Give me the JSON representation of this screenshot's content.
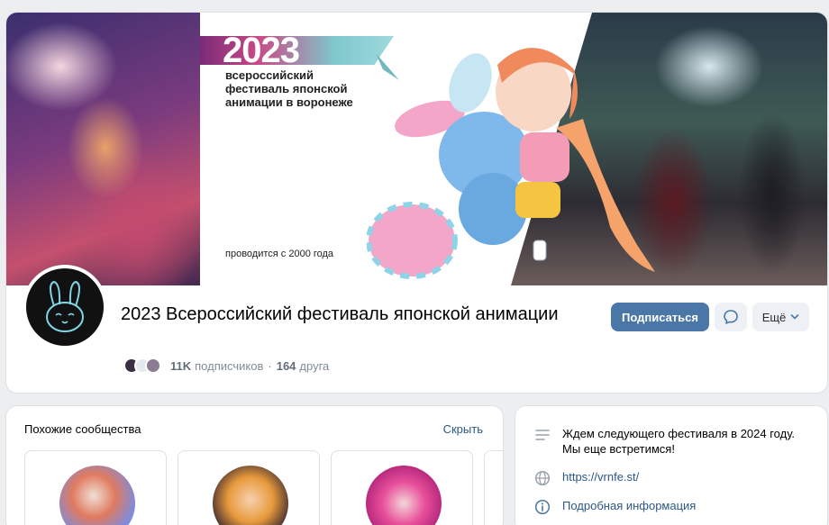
{
  "cover": {
    "year": "2023",
    "festival_name": "всероссийский фестиваль японской анимации в воронеже",
    "since": "проводится с 2000 года"
  },
  "group": {
    "title": "2023 Всероссийский фестиваль японской анимации",
    "subscribers_count": "11K",
    "subscribers_label": "подписчиков",
    "friends_count": "164",
    "friends_label": "друга"
  },
  "actions": {
    "subscribe_label": "Подписаться",
    "more_label": "Ещё",
    "message_icon": "message-icon",
    "chevron_icon": "chevron-down-icon"
  },
  "similar": {
    "title": "Похожие сообщества",
    "hide_label": "Скрыть"
  },
  "info": {
    "status": "Ждем следующего фестиваля в 2024 году. Мы еще встретимся!",
    "website": "https://vrnfe.st/",
    "details_label": "Подробная информация"
  },
  "colors": {
    "accent": "#4a76a8",
    "link": "#2a5885",
    "muted": "#818c99",
    "background": "#edeef0"
  }
}
